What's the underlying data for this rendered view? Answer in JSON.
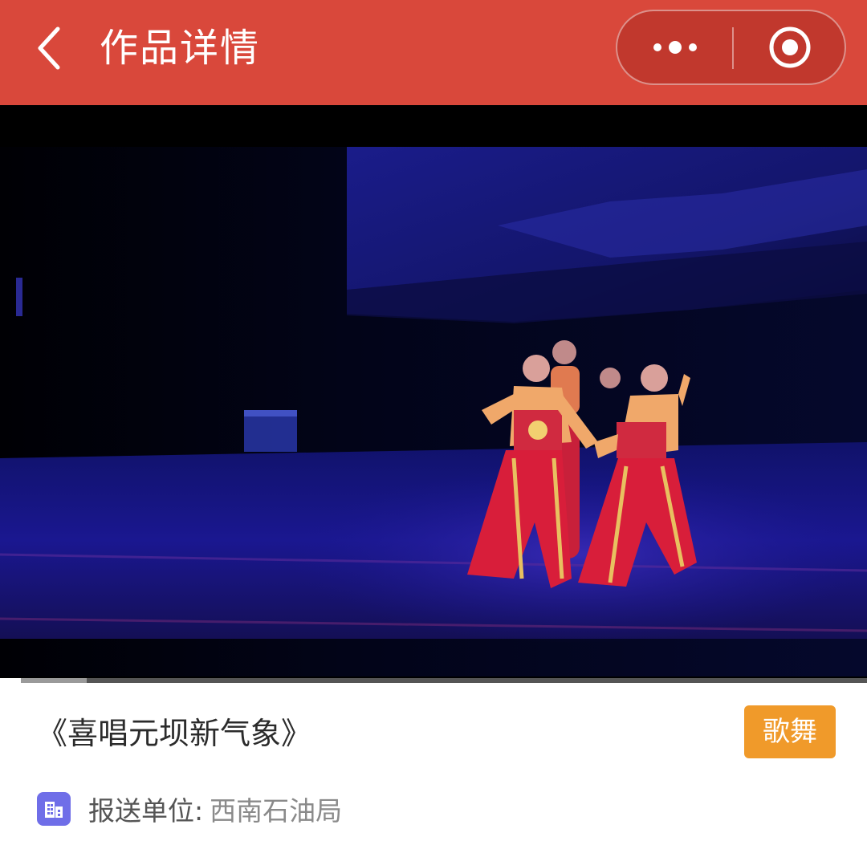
{
  "header": {
    "title": "作品详情",
    "back_icon": "chevron-left-icon",
    "more_icon": "more-dots-icon",
    "close_icon": "record-circle-icon",
    "background_color": "#d9483b"
  },
  "video": {
    "progress_fraction": 0.1
  },
  "work": {
    "title": "《喜唱元坝新气象》",
    "genre": "歌舞",
    "org_label": "报送单位:",
    "org_value": "西南石油局",
    "org_icon": "building-icon",
    "tag_color": "#f09a2a"
  }
}
